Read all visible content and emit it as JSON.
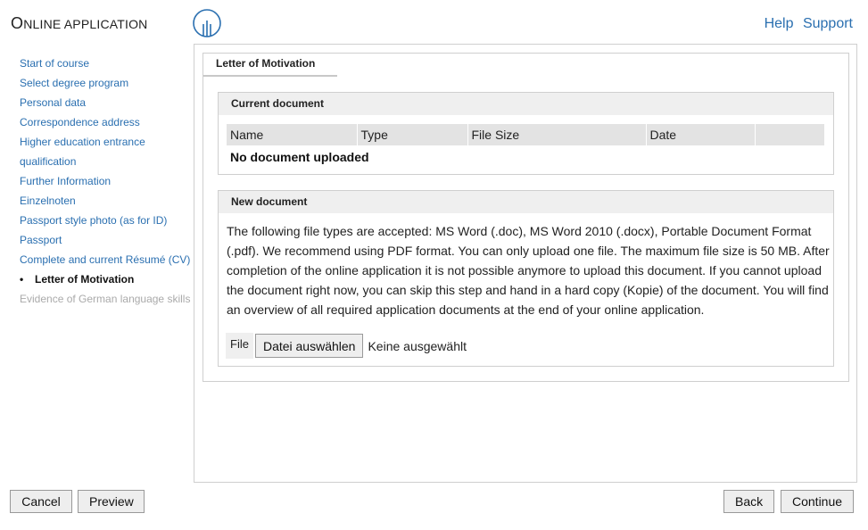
{
  "header": {
    "title_first_letter": "O",
    "title_rest": "NLINE APPLICATION",
    "help_label": "Help",
    "support_label": "Support"
  },
  "sidebar": {
    "items": [
      {
        "label": "Start of course",
        "state": "link"
      },
      {
        "label": "Select degree program",
        "state": "link"
      },
      {
        "label": "Personal data",
        "state": "link"
      },
      {
        "label": "Correspondence address",
        "state": "link"
      },
      {
        "label": "Higher education entrance",
        "state": "link"
      },
      {
        "label": "qualification",
        "state": "link"
      },
      {
        "label": "Further Information",
        "state": "link"
      },
      {
        "label": "Einzelnoten",
        "state": "link"
      },
      {
        "label": "Passport style photo (as for ID)",
        "state": "link"
      },
      {
        "label": "Passport",
        "state": "link"
      },
      {
        "label": "Complete and current Résumé (CV)",
        "state": "link"
      },
      {
        "label": "Letter of Motivation",
        "state": "current"
      },
      {
        "label": "Evidence of German language skills",
        "state": "disabled"
      }
    ]
  },
  "main": {
    "tab_label": "Letter of Motivation",
    "current_document": {
      "title": "Current document",
      "columns": [
        "Name",
        "Type",
        "File Size",
        "Date",
        ""
      ],
      "empty_message": "No document uploaded"
    },
    "new_document": {
      "title": "New document",
      "description": "The following file types are accepted: MS Word (.doc), MS Word 2010 (.docx), Portable Document Format (.pdf). We recommend using PDF format. You can only upload one file. The maximum file size is 50 MB. After completion of the online application it is not possible anymore to upload this document. If you cannot upload the document right now, you can skip this step and hand in a hard copy (Kopie) of the document. You will find an overview of all required application documents at the end of your online application.",
      "file_label": "File",
      "choose_button": "Datei auswählen",
      "file_status": "Keine ausgewählt"
    }
  },
  "footer": {
    "cancel_label": "Cancel",
    "preview_label": "Preview",
    "back_label": "Back",
    "continue_label": "Continue"
  },
  "colors": {
    "link": "#2a6fb0",
    "header_bg": "#efefef",
    "table_header_bg": "#e3e3e3",
    "border": "#cfcfcf",
    "disabled": "#aaaaaa"
  },
  "icons": {
    "logo": "university-logo-icon"
  }
}
